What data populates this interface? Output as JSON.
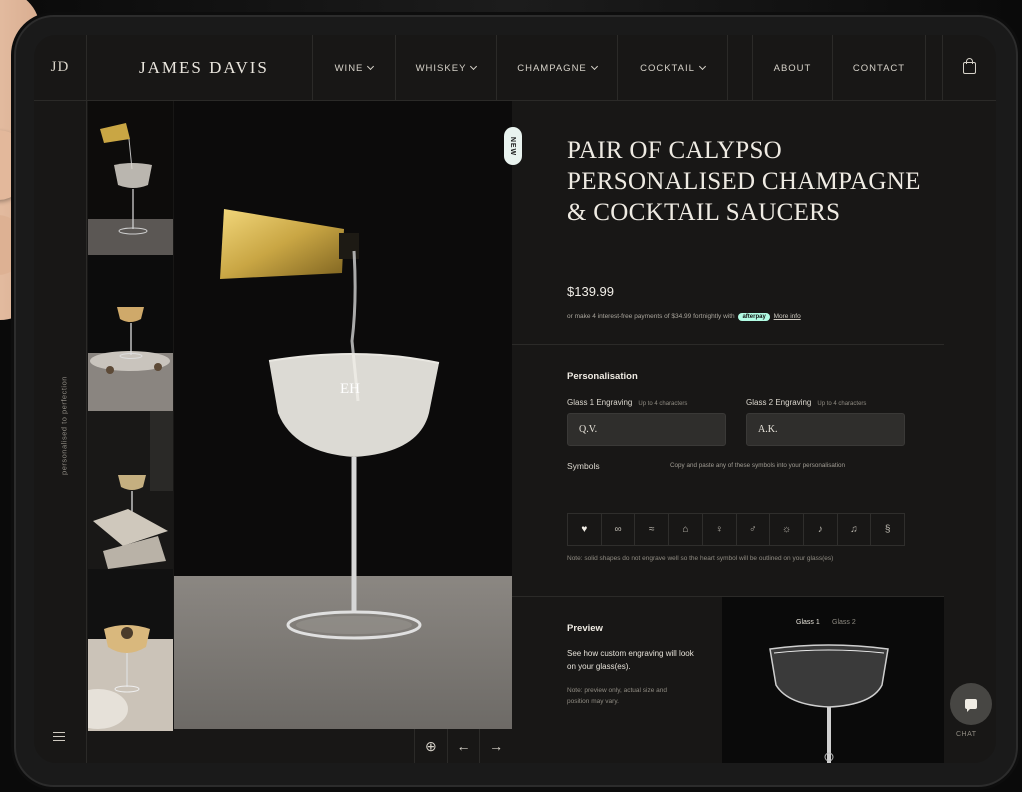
{
  "header": {
    "logo_mark": "JD",
    "brand": "JAMES DAVIS",
    "nav": [
      {
        "label": "WINE",
        "dropdown": true
      },
      {
        "label": "WHISKEY",
        "dropdown": true
      },
      {
        "label": "CHAMPAGNE",
        "dropdown": true
      },
      {
        "label": "COCKTAIL",
        "dropdown": true
      },
      {
        "label": "ABOUT",
        "dropdown": false
      },
      {
        "label": "CONTACT",
        "dropdown": false
      }
    ],
    "cart_icon": "shopping-bag-icon"
  },
  "sidebar": {
    "tagline": "personalised to perfection",
    "menu_icon": "hamburger-icon"
  },
  "gallery": {
    "badge": "NEW",
    "main_engraving": "EH",
    "controls": [
      "zoom-icon",
      "arrow-left-icon",
      "arrow-right-icon"
    ]
  },
  "product": {
    "title": "PAIR OF CALYPSO PERSONALISED CHAMPAGNE & COCKTAIL SAUCERS",
    "price": "$139.99",
    "afterpay_text": "or make 4 interest-free payments of $34.99 fortnightly with",
    "afterpay_badge": "afterpay",
    "afterpay_more": "More info"
  },
  "personalisation": {
    "heading": "Personalisation",
    "glass1_label": "Glass 1 Engraving",
    "glass1_hint": "Up to 4 characters",
    "glass1_value": "Q.V.",
    "glass2_label": "Glass 2 Engraving",
    "glass2_hint": "Up to 4 characters",
    "glass2_value": "A.K.",
    "symbols_label": "Symbols",
    "symbols_hint": "Copy and paste any of these symbols into your personalisation",
    "symbols": [
      "♥",
      "∞",
      "≈",
      "⌂",
      "♀",
      "♂",
      "☼",
      "♪",
      "♫",
      "§"
    ],
    "note": "Note: solid shapes do not engrave well so the heart symbol will be outlined on your glass(es)"
  },
  "preview": {
    "heading": "Preview",
    "desc": "See how custom engraving will look on your glass(es).",
    "note": "Note: preview only, actual size and position may vary.",
    "tab1": "Glass 1",
    "tab2": "Glass 2"
  },
  "chat": {
    "label": "CHAT"
  },
  "colors": {
    "background": "#181716",
    "divider": "#2b2a28",
    "field": "#2f2e2c",
    "afterpay": "#b2fce4",
    "gold": "#c9a644"
  }
}
